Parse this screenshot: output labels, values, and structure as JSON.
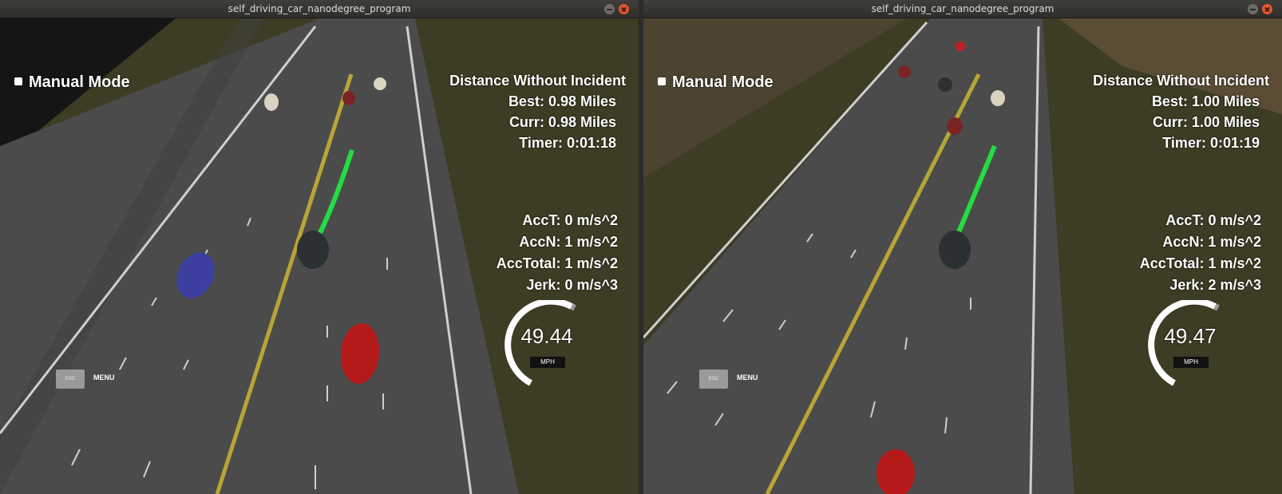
{
  "windows": [
    {
      "title": "self_driving_car_nanodegree_program",
      "mode": "Manual Mode",
      "distance_header": "Distance Without Incident",
      "best": "Best: 0.98 Miles",
      "curr": "Curr: 0.98 Miles",
      "timer": "Timer: 0:01:18",
      "acc_t": "AccT: 0 m/s^2",
      "acc_n": "AccN: 1 m/s^2",
      "acc_total": "AccTotal: 1 m/s^2",
      "jerk": "Jerk: 0 m/s^3",
      "speed": "49.44",
      "speed_unit": "MPH",
      "esc_key": "ESC",
      "menu_label": "MENU"
    },
    {
      "title": "self_driving_car_nanodegree_program",
      "mode": "Manual Mode",
      "distance_header": "Distance Without Incident",
      "best": "Best: 1.00 Miles",
      "curr": "Curr: 1.00 Miles",
      "timer": "Timer: 0:01:19",
      "acc_t": "AccT: 0 m/s^2",
      "acc_n": "AccN: 1 m/s^2",
      "acc_total": "AccTotal: 1 m/s^2",
      "jerk": "Jerk: 2 m/s^3",
      "speed": "49.47",
      "speed_unit": "MPH",
      "esc_key": "ESC",
      "menu_label": "MENU"
    }
  ],
  "colors": {
    "road": "#4a4a4a",
    "grass": "#3b3a22",
    "path": "#22dd44",
    "lane_yellow": "#c9b23a"
  }
}
